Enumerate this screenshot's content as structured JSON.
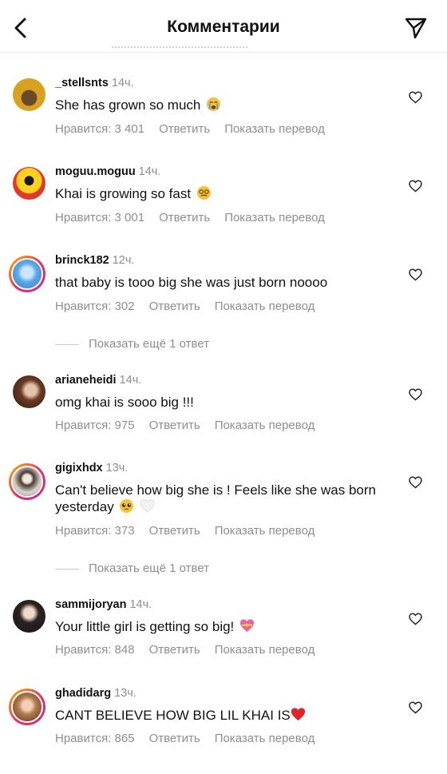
{
  "header": {
    "title": "Комментарии"
  },
  "comments": [
    {
      "username": "_stellsnts",
      "time": "14ч.",
      "text": "She has grown so much",
      "likes": "Нравится: 3 401",
      "reply": "Ответить",
      "translate": "Показать перевод",
      "emoji": "crying-face"
    },
    {
      "username": "moguu.moguu",
      "time": "14ч.",
      "text": "Khai is growing so fast",
      "likes": "Нравится: 3 001",
      "reply": "Ответить",
      "translate": "Показать перевод",
      "emoji": "dizzy-face"
    },
    {
      "username": "brinck182",
      "time": "12ч.",
      "text": "that baby is tooo big she was just born noooo",
      "likes": "Нравится: 302",
      "reply": "Ответить",
      "translate": "Показать перевод"
    },
    {
      "username": "arianeheidi",
      "time": "14ч.",
      "text": "omg khai is sooo big !!!",
      "likes": "Нравится: 975",
      "reply": "Ответить",
      "translate": "Показать перевод"
    },
    {
      "username": "gigixhdx",
      "time": "13ч.",
      "text": "Can't believe how big she is ! Feels like she was born yesterday",
      "likes": "Нравится: 373",
      "reply": "Ответить",
      "translate": "Показать перевод",
      "emoji": "pleading-face-white-heart"
    },
    {
      "username": "sammijoryan",
      "time": "14ч.",
      "text": "Your little girl is getting so big!",
      "likes": "Нравится: 848",
      "reply": "Ответить",
      "translate": "Показать перевод",
      "emoji": "heart-with-ribbon"
    },
    {
      "username": "ghadidarg",
      "time": "13ч.",
      "text": "CANT BELIEVE HOW BIG LIL KHAI IS",
      "likes": "Нравится: 865",
      "reply": "Ответить",
      "translate": "Показать перевод",
      "emoji": "red-heart"
    }
  ],
  "more_replies": [
    "Показать ещё 1 ответ",
    "Показать ещё 1 ответ"
  ],
  "colors": {
    "text": "#111111",
    "muted": "#8e8e8e",
    "story_ring_start": "#f8b500",
    "story_ring_end": "#c13584",
    "heart_red": "#e0242c"
  }
}
